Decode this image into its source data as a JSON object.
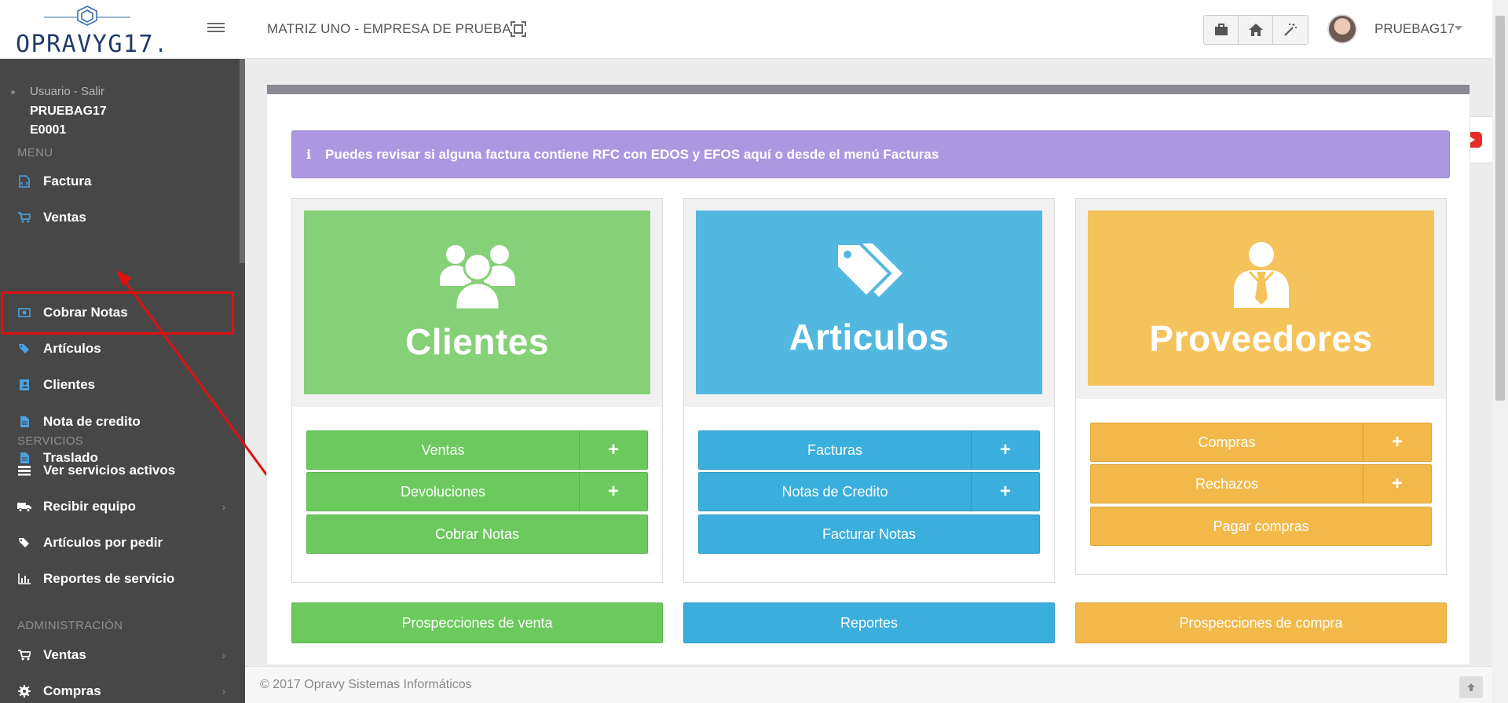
{
  "topbar": {
    "logo_text": "OPRAVYG17.0",
    "company": "MATRIZ UNO - EMPRESA DE PRUEBA",
    "username": "PRUEBAG17",
    "icons": [
      "briefcase-icon",
      "home-icon",
      "magic-wand-icon"
    ]
  },
  "sidebar": {
    "user_link": "Usuario - Salir",
    "user_name": "PRUEBAG17",
    "user_code": "E0001",
    "menu_header": "MENU",
    "menu_items": [
      {
        "label": "Factura",
        "icon": "file-code-icon"
      },
      {
        "label": "Ventas",
        "icon": "cart-icon"
      },
      {
        "label": "Cobrar Notas",
        "icon": "money-icon"
      },
      {
        "label": "Artículos",
        "icon": "tags-icon"
      },
      {
        "label": "Clientes",
        "icon": "address-book-icon"
      },
      {
        "label": "Nota de credito",
        "icon": "file-text-icon"
      },
      {
        "label": "Traslado",
        "icon": "file-text-icon"
      }
    ],
    "services_header": "SERVICIOS",
    "service_items": [
      {
        "label": "Ver servicios activos",
        "icon": "list-icon"
      },
      {
        "label": "Recibir equipo",
        "icon": "truck-icon"
      },
      {
        "label": "Artículos por pedir",
        "icon": "tags-icon"
      },
      {
        "label": "Reportes de servicio",
        "icon": "bar-chart-icon"
      }
    ],
    "admin_header": "ADMINISTRACIÓN",
    "admin_items": [
      {
        "label": "Ventas",
        "icon": "cart-icon"
      },
      {
        "label": "Compras",
        "icon": "gear-icon"
      }
    ]
  },
  "alert": {
    "text": "Puedes revisar si alguna factura contiene RFC con EDOS y EFOS aquí o desde el menú Facturas"
  },
  "cards": {
    "clientes": {
      "title": "Clientes",
      "color": "#86d077",
      "buttons": [
        "Ventas",
        "Devoluciones",
        "Cobrar Notas"
      ],
      "bottom": "Prospecciones de venta"
    },
    "articulos": {
      "title": "Articulos",
      "color": "#53b8e0",
      "buttons": [
        "Facturas",
        "Notas de Credito",
        "Facturar Notas"
      ],
      "bottom": "Reportes"
    },
    "proveedores": {
      "title": "Proveedores",
      "color": "#f5c35b",
      "buttons": [
        "Compras",
        "Rechazos",
        "Pagar compras"
      ],
      "bottom": "Prospecciones de compra"
    }
  },
  "plus": "+",
  "footer": {
    "text": "© 2017 Opravy Sistemas Informáticos"
  },
  "colors": {
    "sidebar_bg": "#474747",
    "green": "#6cc95e",
    "blue": "#3aaedc",
    "yellow": "#f2b94a",
    "alert_bg": "#ac98e0",
    "highlight": "#e01010"
  }
}
